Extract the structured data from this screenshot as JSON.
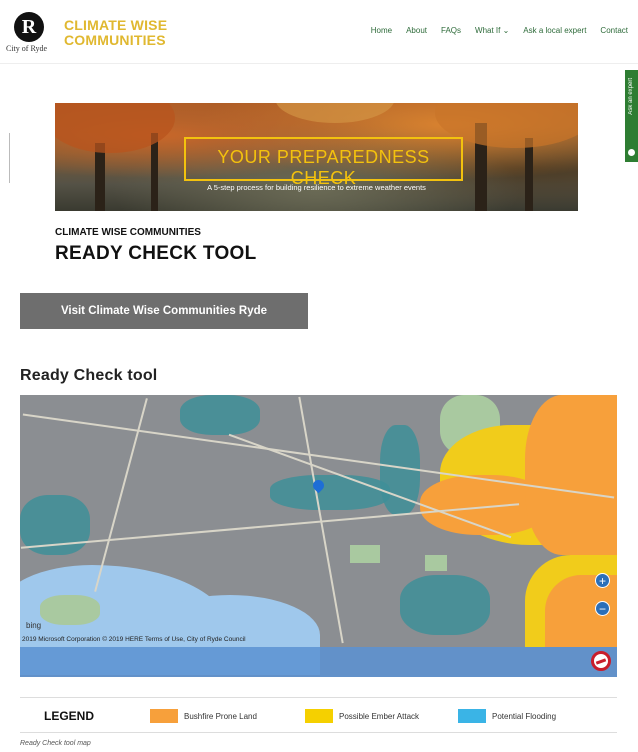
{
  "header": {
    "logo_letter": "R",
    "logo_caption": "City of Ryde",
    "brand_line1": "CLIMATE WISE",
    "brand_line2": "COMMUNITIES",
    "nav": [
      "Home",
      "About",
      "FAQs",
      "What If ⌄",
      "Ask a local expert",
      "Contact"
    ]
  },
  "side_tab": {
    "label": "Ask an expert"
  },
  "hero": {
    "title": "YOUR PREPAREDNESS CHECK",
    "subtitle": "A 5-step process for building resilience to extreme weather events"
  },
  "intro": {
    "kicker": "CLIMATE WISE COMMUNITIES",
    "title": "READY CHECK TOOL",
    "visit_button": "Visit Climate Wise Communities Ryde"
  },
  "map_section": {
    "heading": "Ready Check tool",
    "provider": "bing",
    "credits": "2019 Microsoft Corporation © 2019 HERE Terms of Use, City of Ryde Council",
    "zoom_in": "+",
    "zoom_out": "−"
  },
  "legend": {
    "title": "LEGEND",
    "items": [
      {
        "label": "Bushfire Prone Land",
        "color": "#f7a03b"
      },
      {
        "label": "Possible Ember Attack",
        "color": "#f5d000"
      },
      {
        "label": "Potential Flooding",
        "color": "#3ab4e6"
      }
    ]
  },
  "caption": "Ready Check tool map"
}
